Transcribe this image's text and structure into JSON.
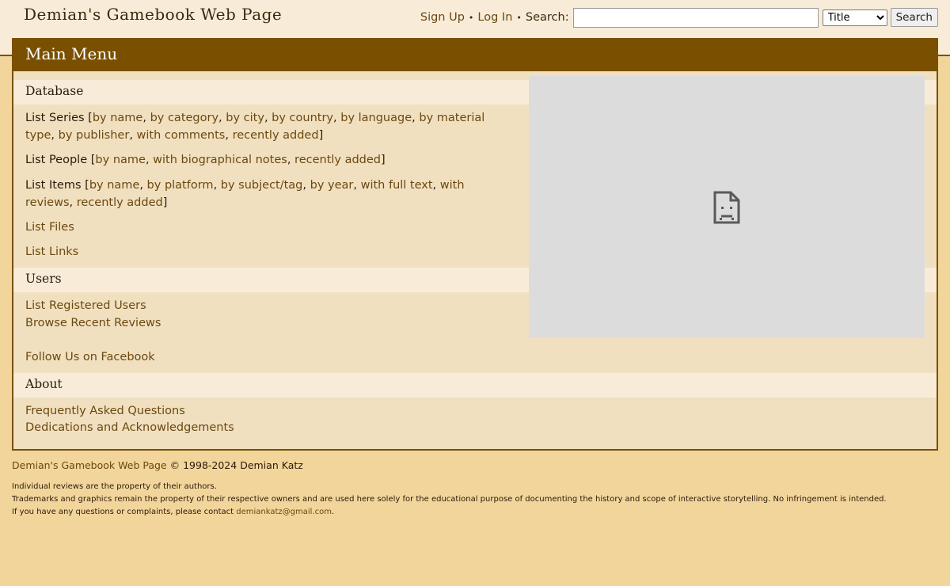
{
  "header": {
    "site_title": "Demian's Gamebook Web Page",
    "sign_up": "Sign Up",
    "log_in": "Log In",
    "separator": "•",
    "search_label": "Search:",
    "search_value": "",
    "search_type": "Title",
    "search_button": "Search"
  },
  "menu": {
    "title": "Main Menu",
    "database_heading": "Database",
    "series_label": "List Series",
    "series_links": [
      "by name",
      "by category",
      "by city",
      "by country",
      "by language",
      "by material type",
      "by publisher",
      "with comments",
      "recently added"
    ],
    "people_label": "List People",
    "people_links": [
      "by name",
      "with biographical notes",
      "recently added"
    ],
    "items_label": "List Items",
    "items_links": [
      "by name",
      "by platform",
      "by subject/tag",
      "by year",
      "with full text",
      "with reviews",
      "recently added"
    ],
    "files": "List Files",
    "links": "List Links",
    "users_heading": "Users",
    "registered_users": "List Registered Users",
    "recent_reviews": "Browse Recent Reviews",
    "facebook": "Follow Us on Facebook",
    "about_heading": "About",
    "faq": "Frequently Asked Questions",
    "dedications": "Dedications and Acknowledgements"
  },
  "image": {
    "icon": "broken-image-icon"
  },
  "footer": {
    "site_link": "Demian's Gamebook Web Page",
    "copyright": "© 1998-2024 Demian Katz",
    "line1": "Individual reviews are the property of their authors.",
    "line2": "Trademarks and graphics remain the property of their respective owners and are used here solely for the educational purpose of documenting the history and scope of interactive storytelling. No infringement is intended.",
    "line3_prefix": "If you have any questions or complaints, please contact",
    "email": "demiankatz@gmail.com",
    "line3_suffix": "."
  },
  "colors": {
    "page_bg": "#f2d59b",
    "header_bg": "#f8ecd9",
    "accent": "#7a5000",
    "panel_bg": "#f1e0c0",
    "link": "#6b4810"
  }
}
